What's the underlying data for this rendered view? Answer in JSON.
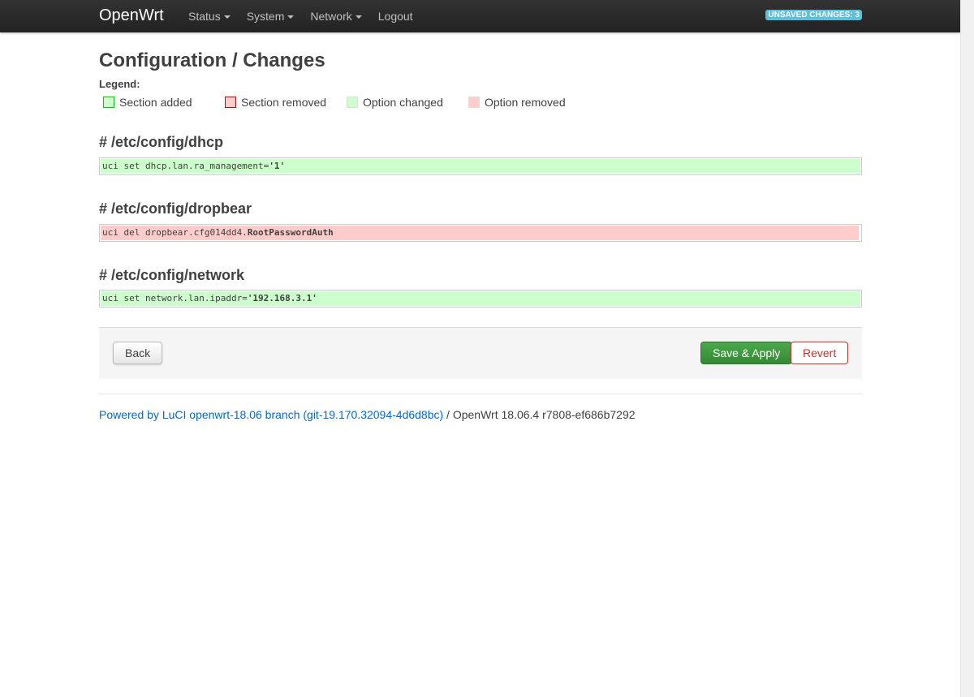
{
  "header": {
    "brand": "OpenWrt",
    "menu": [
      {
        "label": "Status",
        "dropdown": true
      },
      {
        "label": "System",
        "dropdown": true
      },
      {
        "label": "Network",
        "dropdown": true
      },
      {
        "label": "Logout",
        "dropdown": false
      }
    ],
    "unsaved_badge": "UNSAVED CHANGES: 3"
  },
  "page": {
    "title": "Configuration / Changes",
    "legend_label": "Legend:",
    "legend": [
      {
        "label": "Section added",
        "fill": "#ccffcc",
        "border": "#00cc00"
      },
      {
        "label": "Section removed",
        "fill": "#ffcccc",
        "border": "#cc0000"
      },
      {
        "label": "Option changed",
        "fill": "#ccffcc",
        "border": "#dddddd"
      },
      {
        "label": "Option removed",
        "fill": "#ffcccc",
        "border": "#dddddd"
      }
    ]
  },
  "changes": [
    {
      "file": "# /etc/config/dhcp",
      "command": "uci set dhcp.lan.ra_management=",
      "value": "'1'",
      "type": "added"
    },
    {
      "file": "# /etc/config/dropbear",
      "command": "uci del dropbear.cfg014dd4.",
      "value": "RootPasswordAuth",
      "type": "removed"
    },
    {
      "file": "# /etc/config/network",
      "command": "uci set network.lan.ipaddr=",
      "value": "'192.168.3.1'",
      "type": "added"
    }
  ],
  "actions": {
    "back": "Back",
    "apply": "Save & Apply",
    "revert": "Revert"
  },
  "footer": {
    "link_text": "Powered by LuCI openwrt-18.06 branch (git-19.170.32094-4d6d8bc)",
    "suffix": " / OpenWrt 18.06.4 r7808-ef686b7292"
  },
  "colors": {
    "navbar": "#222222",
    "badge": "#5bc0de",
    "apply_button": "#3d9a3d",
    "revert_text": "#c9302c",
    "link": "#0069d6"
  }
}
